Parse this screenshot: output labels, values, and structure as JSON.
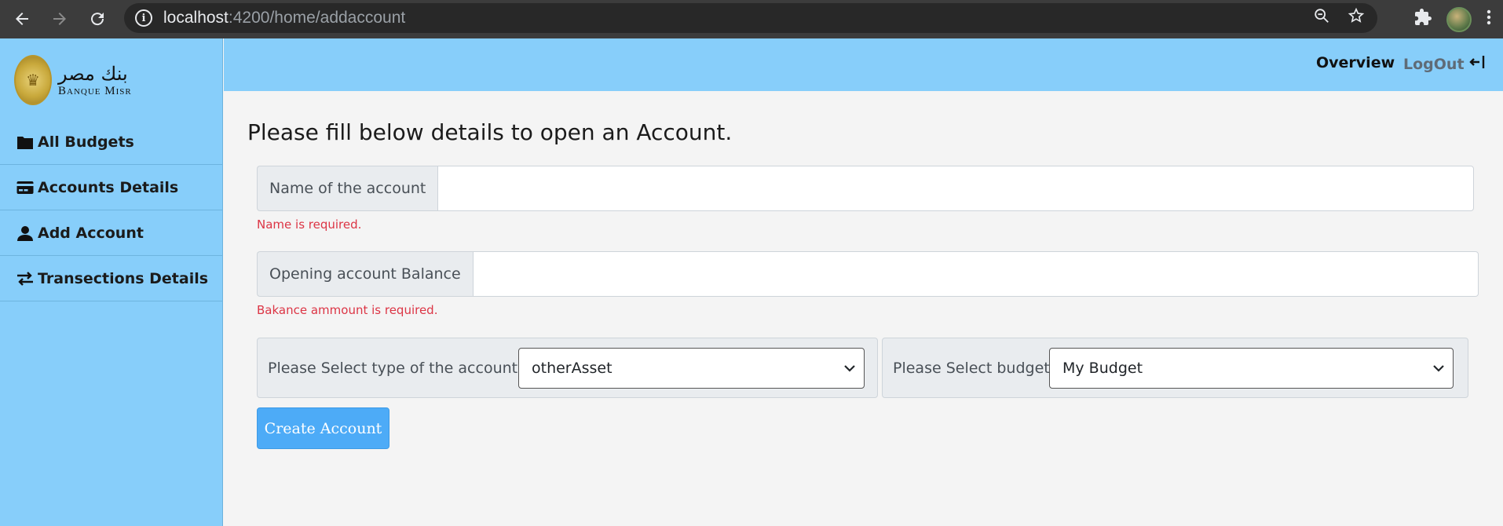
{
  "browser": {
    "url_host": "localhost",
    "url_path": ":4200/home/addaccount"
  },
  "logo": {
    "arabic": "بنك مصر",
    "english": "Banque Misr"
  },
  "sidebar": {
    "items": [
      {
        "label": "All Budgets",
        "icon": "folder-icon"
      },
      {
        "label": "Accounts Details",
        "icon": "credit-card-icon"
      },
      {
        "label": "Add Account",
        "icon": "user-icon"
      },
      {
        "label": "Transections Details",
        "icon": "exchange-icon"
      }
    ]
  },
  "header": {
    "overview_label": "Overview",
    "logout_label": "LogOut"
  },
  "form": {
    "heading": "Please fill below details to open an Account.",
    "name_label": "Name of the account",
    "name_value": "",
    "name_error": "Name is required.",
    "balance_label": "Opening account Balance",
    "balance_value": "",
    "balance_error": "Bakance ammount is required.",
    "type_label": "Please Select type of the account :",
    "type_value": "otherAsset",
    "budget_label": "Please Select budget:",
    "budget_value": "My Budget",
    "submit_label": "Create Account"
  },
  "colors": {
    "sidebar_bg": "#87cefa",
    "error": "#dc3545",
    "button": "#4dabf7"
  }
}
